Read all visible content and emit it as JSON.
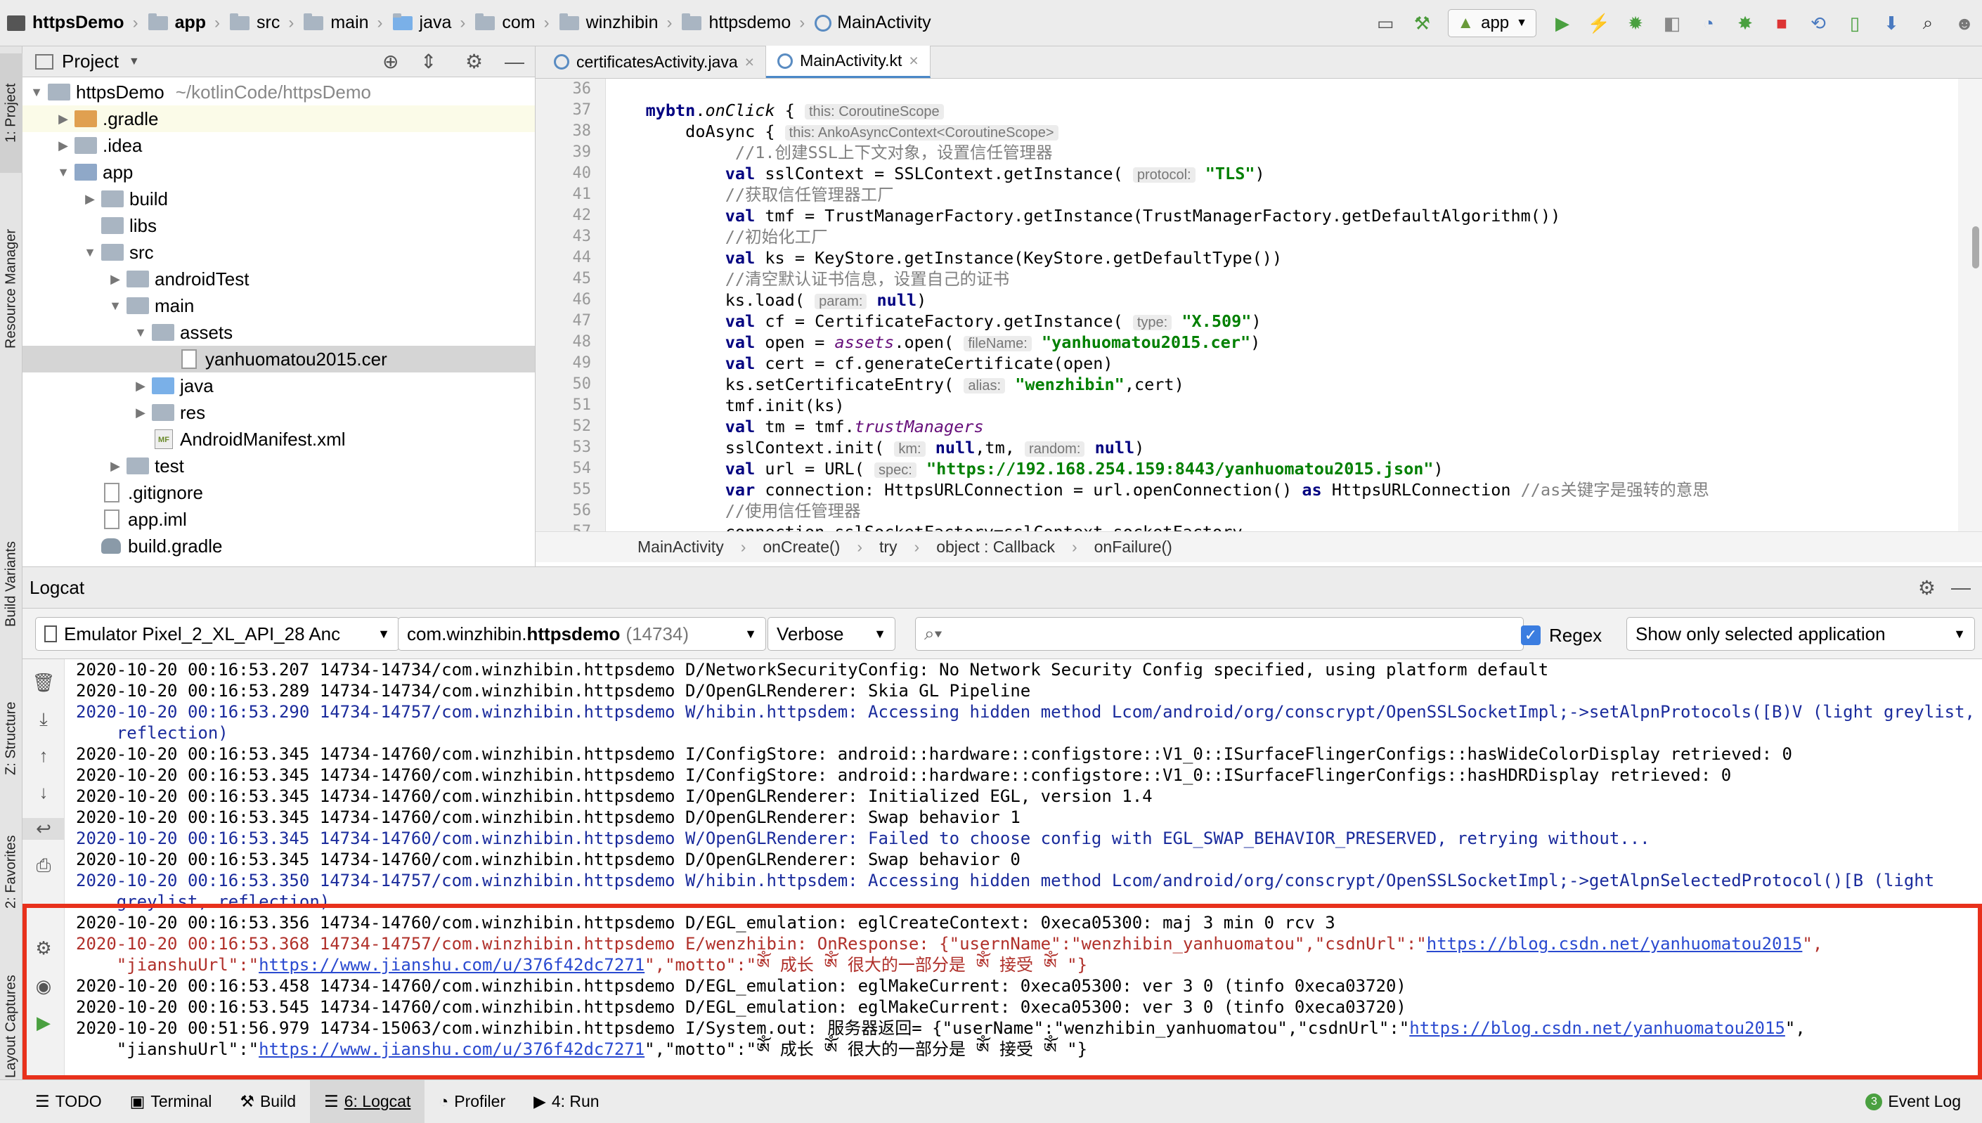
{
  "navbar": {
    "breadcrumbs": [
      "httpsDemo",
      "app",
      "src",
      "main",
      "java",
      "com",
      "winzhibin",
      "httpsdemo",
      "MainActivity"
    ],
    "run_config": "app"
  },
  "left_stripe": {
    "tabs": [
      "1: Project",
      "Resource Manager",
      "Build Variants",
      "Z: Structure",
      "2: Favorites",
      "Layout Captures"
    ]
  },
  "project": {
    "title": "Project",
    "tree": [
      {
        "label": "httpsDemo",
        "extra": "~/kotlinCode/httpsDemo"
      },
      {
        "label": ".gradle"
      },
      {
        "label": ".idea"
      },
      {
        "label": "app"
      },
      {
        "label": "build"
      },
      {
        "label": "libs"
      },
      {
        "label": "src"
      },
      {
        "label": "androidTest"
      },
      {
        "label": "main"
      },
      {
        "label": "assets"
      },
      {
        "label": "yanhuomatou2015.cer"
      },
      {
        "label": "java"
      },
      {
        "label": "res"
      },
      {
        "label": "AndroidManifest.xml"
      },
      {
        "label": "test"
      },
      {
        "label": ".gitignore"
      },
      {
        "label": "app.iml"
      },
      {
        "label": "build.gradle"
      }
    ]
  },
  "editor": {
    "tabs": [
      "certificatesActivity.java",
      "MainActivity.kt"
    ],
    "line_numbers": [
      "36",
      "37",
      "38",
      "39",
      "40",
      "41",
      "42",
      "43",
      "44",
      "45",
      "46",
      "47",
      "48",
      "49",
      "50",
      "51",
      "52",
      "53",
      "54",
      "55",
      "56",
      "57"
    ],
    "breadcrumb": [
      "MainActivity",
      "onCreate()",
      "try",
      "object : Callback",
      "onFailure()"
    ]
  },
  "logcat": {
    "title": "Logcat",
    "device": "Emulator Pixel_2_XL_API_28 Anc",
    "process_prefix": "com.winzhibin.",
    "process_bold": "httpsdemo",
    "process_pid": "(14734)",
    "level": "Verbose",
    "search_placeholder": "",
    "regex_label": "Regex",
    "filter": "Show only selected application",
    "lines": [
      {
        "level": "d",
        "text": "2020-10-20 00:16:53.207 14734-14734/com.winzhibin.httpsdemo D/NetworkSecurityConfig: No Network Security Config specified, using platform default"
      },
      {
        "level": "d",
        "text": "2020-10-20 00:16:53.289 14734-14734/com.winzhibin.httpsdemo D/OpenGLRenderer: Skia GL Pipeline"
      },
      {
        "level": "w",
        "text": "2020-10-20 00:16:53.290 14734-14757/com.winzhibin.httpsdemo W/hibin.httpsdem: Accessing hidden method Lcom/android/org/conscrypt/OpenSSLSocketImpl;->setAlpnProtocols([B)V (light greylist,"
      },
      {
        "level": "w",
        "text": "    reflection)"
      },
      {
        "level": "d",
        "text": "2020-10-20 00:16:53.345 14734-14760/com.winzhibin.httpsdemo I/ConfigStore: android::hardware::configstore::V1_0::ISurfaceFlingerConfigs::hasWideColorDisplay retrieved: 0"
      },
      {
        "level": "d",
        "text": "2020-10-20 00:16:53.345 14734-14760/com.winzhibin.httpsdemo I/ConfigStore: android::hardware::configstore::V1_0::ISurfaceFlingerConfigs::hasHDRDisplay retrieved: 0"
      },
      {
        "level": "d",
        "text": "2020-10-20 00:16:53.345 14734-14760/com.winzhibin.httpsdemo I/OpenGLRenderer: Initialized EGL, version 1.4"
      },
      {
        "level": "d",
        "text": "2020-10-20 00:16:53.345 14734-14760/com.winzhibin.httpsdemo D/OpenGLRenderer: Swap behavior 1"
      },
      {
        "level": "w",
        "text": "2020-10-20 00:16:53.345 14734-14760/com.winzhibin.httpsdemo W/OpenGLRenderer: Failed to choose config with EGL_SWAP_BEHAVIOR_PRESERVED, retrying without..."
      },
      {
        "level": "d",
        "text": "2020-10-20 00:16:53.345 14734-14760/com.winzhibin.httpsdemo D/OpenGLRenderer: Swap behavior 0"
      },
      {
        "level": "w",
        "text": "2020-10-20 00:16:53.350 14734-14757/com.winzhibin.httpsdemo W/hibin.httpsdem: Accessing hidden method Lcom/android/org/conscrypt/OpenSSLSocketImpl;->getAlpnSelectedProtocol()[B (light"
      },
      {
        "level": "w",
        "text": "    greylist, reflection)"
      },
      {
        "level": "d",
        "text": "2020-10-20 00:16:53.356 14734-14760/com.winzhibin.httpsdemo D/EGL_emulation: eglCreateContext: 0xeca05300: maj 3 min 0 rcv 3"
      },
      {
        "level": "e",
        "text": "2020-10-20 00:16:53.368 14734-14757/com.winzhibin.httpsdemo E/wenzhibin: OnResponse: {\"usernName\":\"wenzhibin_yanhuomatou\",\"csdnUrl\":\"",
        "link": "https://blog.csdn.net/yanhuomatou2015",
        "after": "\","
      },
      {
        "level": "e",
        "text": "    \"jianshuUrl\":\"",
        "link": "https://www.jianshu.com/u/376f42dc7271",
        "after": "\",\"motto\":\"ༀ 成长 ༀ 很大的一部分是 ༀ 接受 ༀ \"}"
      },
      {
        "level": "d",
        "text": "2020-10-20 00:16:53.458 14734-14760/com.winzhibin.httpsdemo D/EGL_emulation: eglMakeCurrent: 0xeca05300: ver 3 0 (tinfo 0xeca03720)"
      },
      {
        "level": "d",
        "text": "2020-10-20 00:16:53.545 14734-14760/com.winzhibin.httpsdemo D/EGL_emulation: eglMakeCurrent: 0xeca05300: ver 3 0 (tinfo 0xeca03720)"
      },
      {
        "level": "d",
        "text": "2020-10-20 00:51:56.979 14734-15063/com.winzhibin.httpsdemo I/System.out: 服务器返回= {\"userName\":\"wenzhibin_yanhuomatou\",\"csdnUrl\":\"",
        "link": "https://blog.csdn.net/yanhuomatou2015",
        "after": "\","
      },
      {
        "level": "d",
        "text": "    \"jianshuUrl\":\"",
        "link": "https://www.jianshu.com/u/376f42dc7271",
        "after": "\",\"motto\":\"ༀ 成长 ༀ 很大的一部分是 ༀ 接受 ༀ \"}"
      }
    ]
  },
  "bottom": {
    "tabs": [
      "TODO",
      "Terminal",
      "Build",
      "6: Logcat",
      "Profiler",
      "4: Run"
    ],
    "event_log": "Event Log",
    "event_count": "3"
  },
  "colors": {
    "accent": "#4a88c7",
    "highlight_box": "#e8311c",
    "warn": "#1a2b9c",
    "error": "#b0302a"
  }
}
